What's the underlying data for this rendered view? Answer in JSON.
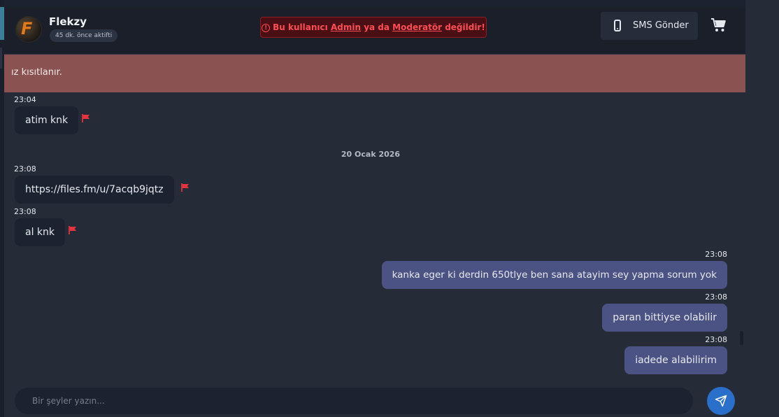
{
  "header": {
    "user_name": "Flekzy",
    "user_status": "45 dk. önce aktifti",
    "avatar_letter": "F",
    "warning": {
      "prefix": "Bu kullanıcı",
      "admin": "Admin",
      "middle": "ya da",
      "moderator": "Moderatör",
      "suffix": "değildir!"
    },
    "sms_button_label": "SMS Gönder",
    "cart_icon": "cart-icon"
  },
  "notice": {
    "text": "ız kısıtlanır."
  },
  "day_separator": "20 Ocak 2026",
  "messages": [
    {
      "time": "23:04",
      "text": "atim knk",
      "direction": "incoming"
    },
    {
      "time": "23:08",
      "text": "https://files.fm/u/7acqb9jqtz",
      "direction": "incoming"
    },
    {
      "time": "23:08",
      "text": "al knk",
      "direction": "incoming"
    },
    {
      "time": "23:08",
      "text": "kanka eger ki derdin 650tlye ben sana atayim sey yapma sorum yok",
      "direction": "outgoing"
    },
    {
      "time": "23:08",
      "text": "paran bittiyse olabilir",
      "direction": "outgoing"
    },
    {
      "time": "23:08",
      "text": "iadede alabilirim",
      "direction": "outgoing"
    }
  ],
  "composer": {
    "placeholder": "Bir şeyler yazın...",
    "value": ""
  },
  "colors": {
    "accent": "#2a6fc9",
    "outgoing_bubble": "#4b5384",
    "incoming_bubble": "#1d2230",
    "warning_text": "#ff4d55",
    "notice_bg": "#8a5250",
    "flag": "#e5343d"
  }
}
